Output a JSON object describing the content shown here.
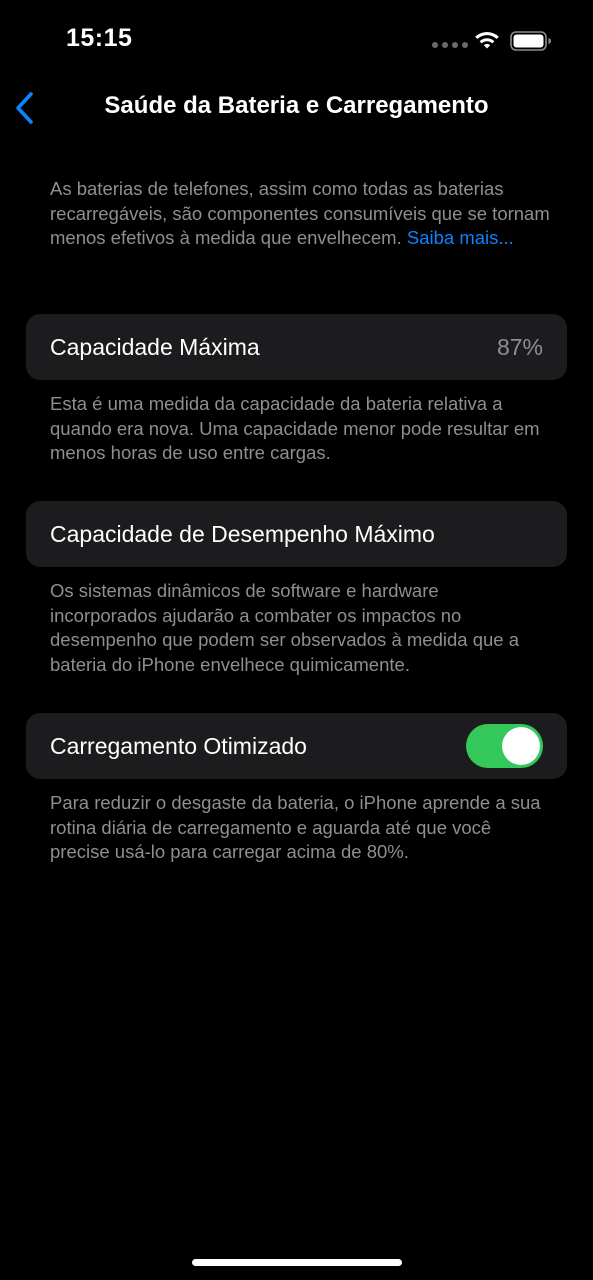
{
  "status_bar": {
    "time": "15:15",
    "icons": [
      "signal-dots-icon",
      "wifi-icon",
      "battery-icon"
    ]
  },
  "nav": {
    "back_icon": "chevron-left-icon",
    "title": "Saúde da Bateria e Carregamento"
  },
  "intro": {
    "text": "As baterias de telefones, assim como todas as baterias recarregáveis, são componentes consumíveis que se tornam menos efetivos à medida que envelhecem. ",
    "link": "Saiba mais..."
  },
  "max_capacity": {
    "label": "Capacidade Máxima",
    "value": "87%",
    "footer": "Esta é uma medida da capacidade da bateria relativa a quando era nova. Uma capacidade menor pode resultar em menos horas de uso entre cargas."
  },
  "peak_performance": {
    "label": "Capacidade de Desempenho Máximo",
    "footer": "Os sistemas dinâmicos de software e hardware incorporados ajudarão a combater os impactos no desempenho que podem ser observados à medida que a bateria do iPhone envelhece quimicamente."
  },
  "optimized_charging": {
    "label": "Carregamento Otimizado",
    "enabled": true,
    "footer": "Para reduzir o desgaste da bateria, o iPhone aprende a sua rotina diária de carregamento e aguarda até que você precise usá-lo para carregar acima de 80%."
  },
  "colors": {
    "background": "#000000",
    "card": "#1c1c1e",
    "secondary_text": "#8e8e93",
    "link": "#0a84ff",
    "toggle_on": "#34c759"
  }
}
